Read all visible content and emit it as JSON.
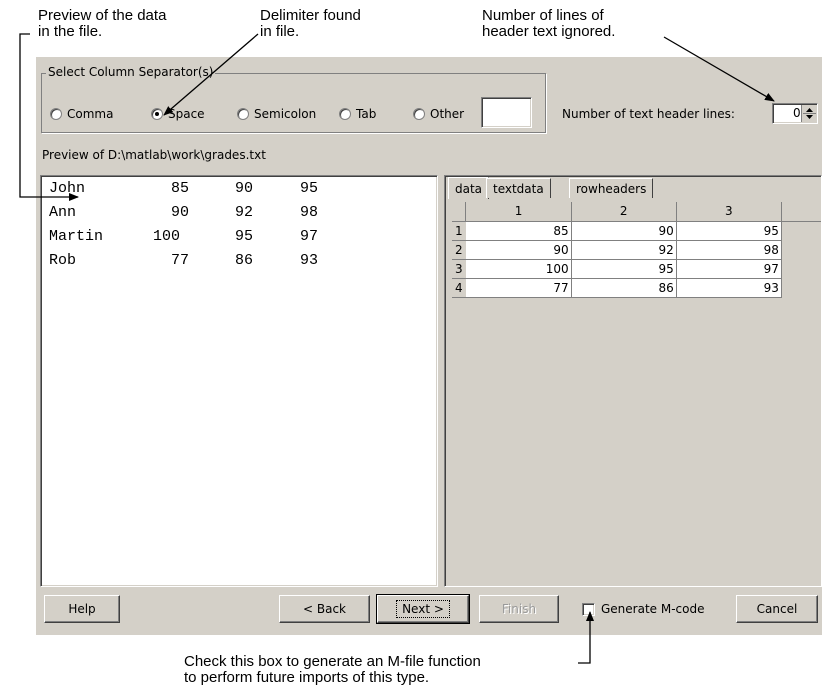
{
  "annotations": {
    "preview_note": "Preview of the data\nin the file.",
    "delimiter_note": "Delimiter found\nin file.",
    "header_note": "Number of lines of\nheader text ignored.",
    "mcode_note": "Check this box to generate an M-file function\nto perform future imports of this type."
  },
  "separator_group": {
    "legend": "Select Column Separator(s)",
    "options": [
      "Comma",
      "Space",
      "Semicolon",
      "Tab",
      "Other"
    ],
    "selected": "Space",
    "other_value": ""
  },
  "header_lines": {
    "label": "Number of text header lines:",
    "value": "0"
  },
  "preview": {
    "label": "Preview of D:\\matlab\\work\\grades.txt",
    "rows": [
      [
        "John",
        "85",
        "90",
        "95"
      ],
      [
        "Ann",
        "90",
        "92",
        "98"
      ],
      [
        "Martin",
        "100",
        "95",
        "97"
      ],
      [
        "Rob",
        "77",
        "86",
        "93"
      ]
    ]
  },
  "tabs": [
    "data",
    "textdata",
    "rowheaders"
  ],
  "active_tab": "data",
  "grid": {
    "columns": [
      "1",
      "2",
      "3"
    ],
    "row_labels": [
      "1",
      "2",
      "3",
      "4"
    ],
    "rows": [
      [
        "85",
        "90",
        "95"
      ],
      [
        "90",
        "92",
        "98"
      ],
      [
        "100",
        "95",
        "97"
      ],
      [
        "77",
        "86",
        "93"
      ]
    ]
  },
  "buttons": {
    "help": "Help",
    "back": "< Back",
    "next": "Next >",
    "finish": "Finish",
    "generate_mcode": "Generate M-code",
    "cancel": "Cancel"
  },
  "generate_mcode_checked": false
}
